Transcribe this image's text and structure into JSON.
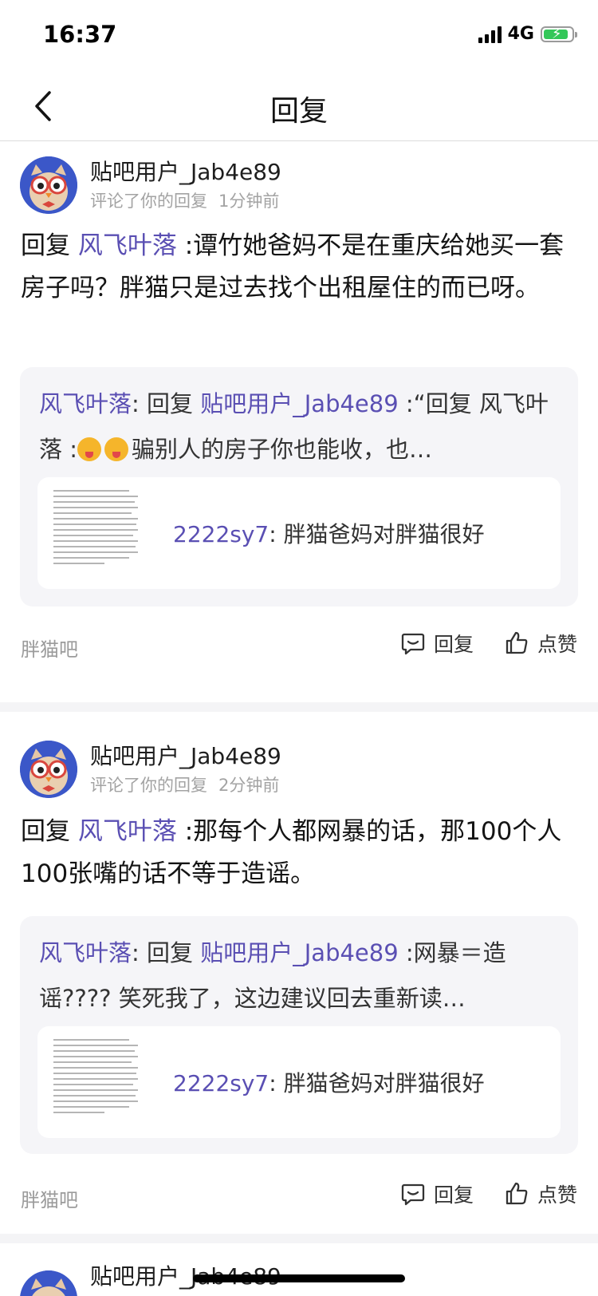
{
  "status_bar": {
    "time": "16:37",
    "network": "4G"
  },
  "header": {
    "title": "回复"
  },
  "comments": [
    {
      "user": "贴吧用户_Jab4e89",
      "action": "评论了你的回复",
      "time": "1分钟前",
      "reply_prefix": "回复",
      "reply_to": "风飞叶落",
      "text": ":谭竹她爸妈不是在重庆给她买一套房子吗？胖猫只是过去找个出租屋住的而已呀。",
      "quote": {
        "author": "风飞叶落",
        "colon": ":",
        "reply_prefix": "回复",
        "reply_to": "贴吧用户_Jab4e89",
        "text_before": ":“回复 风飞叶落 :",
        "text_after": "骗别人的房子你也能收，也…",
        "inner": {
          "author": "2222sy7",
          "text": ": 胖猫爸妈对胖猫很好"
        }
      },
      "forum": "胖猫吧",
      "reply_label": "回复",
      "like_label": "点赞"
    },
    {
      "user": "贴吧用户_Jab4e89",
      "action": "评论了你的回复",
      "time": "2分钟前",
      "reply_prefix": "回复",
      "reply_to": "风飞叶落",
      "text": ":那每个人都网暴的话，那100个人100张嘴的话不等于造谣。",
      "quote": {
        "author": "风飞叶落",
        "colon": ":",
        "reply_prefix": "回复",
        "reply_to": "贴吧用户_Jab4e89",
        "text_before": ":网暴＝造谣????  笑死我了，这边建议回去重新读…",
        "text_after": "",
        "inner": {
          "author": "2222sy7",
          "text": ": 胖猫爸妈对胖猫很好"
        }
      },
      "forum": "胖猫吧",
      "reply_label": "回复",
      "like_label": "点赞"
    },
    {
      "user": "贴吧用户_Jab4e89"
    }
  ]
}
